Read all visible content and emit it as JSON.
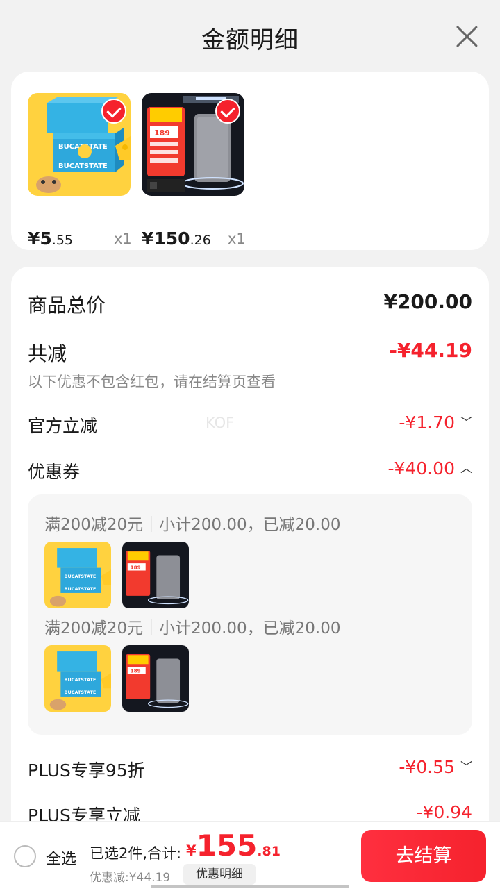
{
  "header": {
    "title": "金额明细"
  },
  "goods": [
    {
      "price_int": "¥5",
      "price_dec": ".55",
      "qty": "x1",
      "checked": true,
      "image": "cheese-snack-product-image"
    },
    {
      "price_int": "¥150",
      "price_dec": ".26",
      "qty": "x1",
      "checked": true,
      "image": "power-bank-product-image"
    }
  ],
  "summary": {
    "total_label": "商品总价",
    "total_value": "¥200.00",
    "reduce_label": "共减",
    "reduce_value": "-¥44.19",
    "reduce_note": "以下优惠不包含红包，请在结算页查看"
  },
  "discounts": {
    "official": {
      "label": "官方立减",
      "value": "-¥1.70"
    },
    "coupon": {
      "label": "优惠券",
      "value": "-¥40.00"
    },
    "plus95": {
      "label": "PLUS专享95折",
      "value": "-¥0.55"
    },
    "plusDirect": {
      "label": "PLUS专享立减",
      "value": "-¥0.94"
    }
  },
  "watermark": "KOF",
  "coupon_groups": [
    {
      "rule": "满200减20元｜小计200.00，已减20.00"
    },
    {
      "rule": "满200减20元｜小计200.00，已减20.00"
    }
  ],
  "bottom": {
    "select_all": "全选",
    "selected_text": "已选2件,合计:",
    "total_symbol": "¥",
    "total_int": "155",
    "total_dec": ".81",
    "saved_text": "优惠减:¥44.19",
    "detail_button": "优惠明细",
    "checkout_button": "去结算"
  },
  "colors": {
    "accent": "#f5222d",
    "background": "#f2f2f2"
  }
}
